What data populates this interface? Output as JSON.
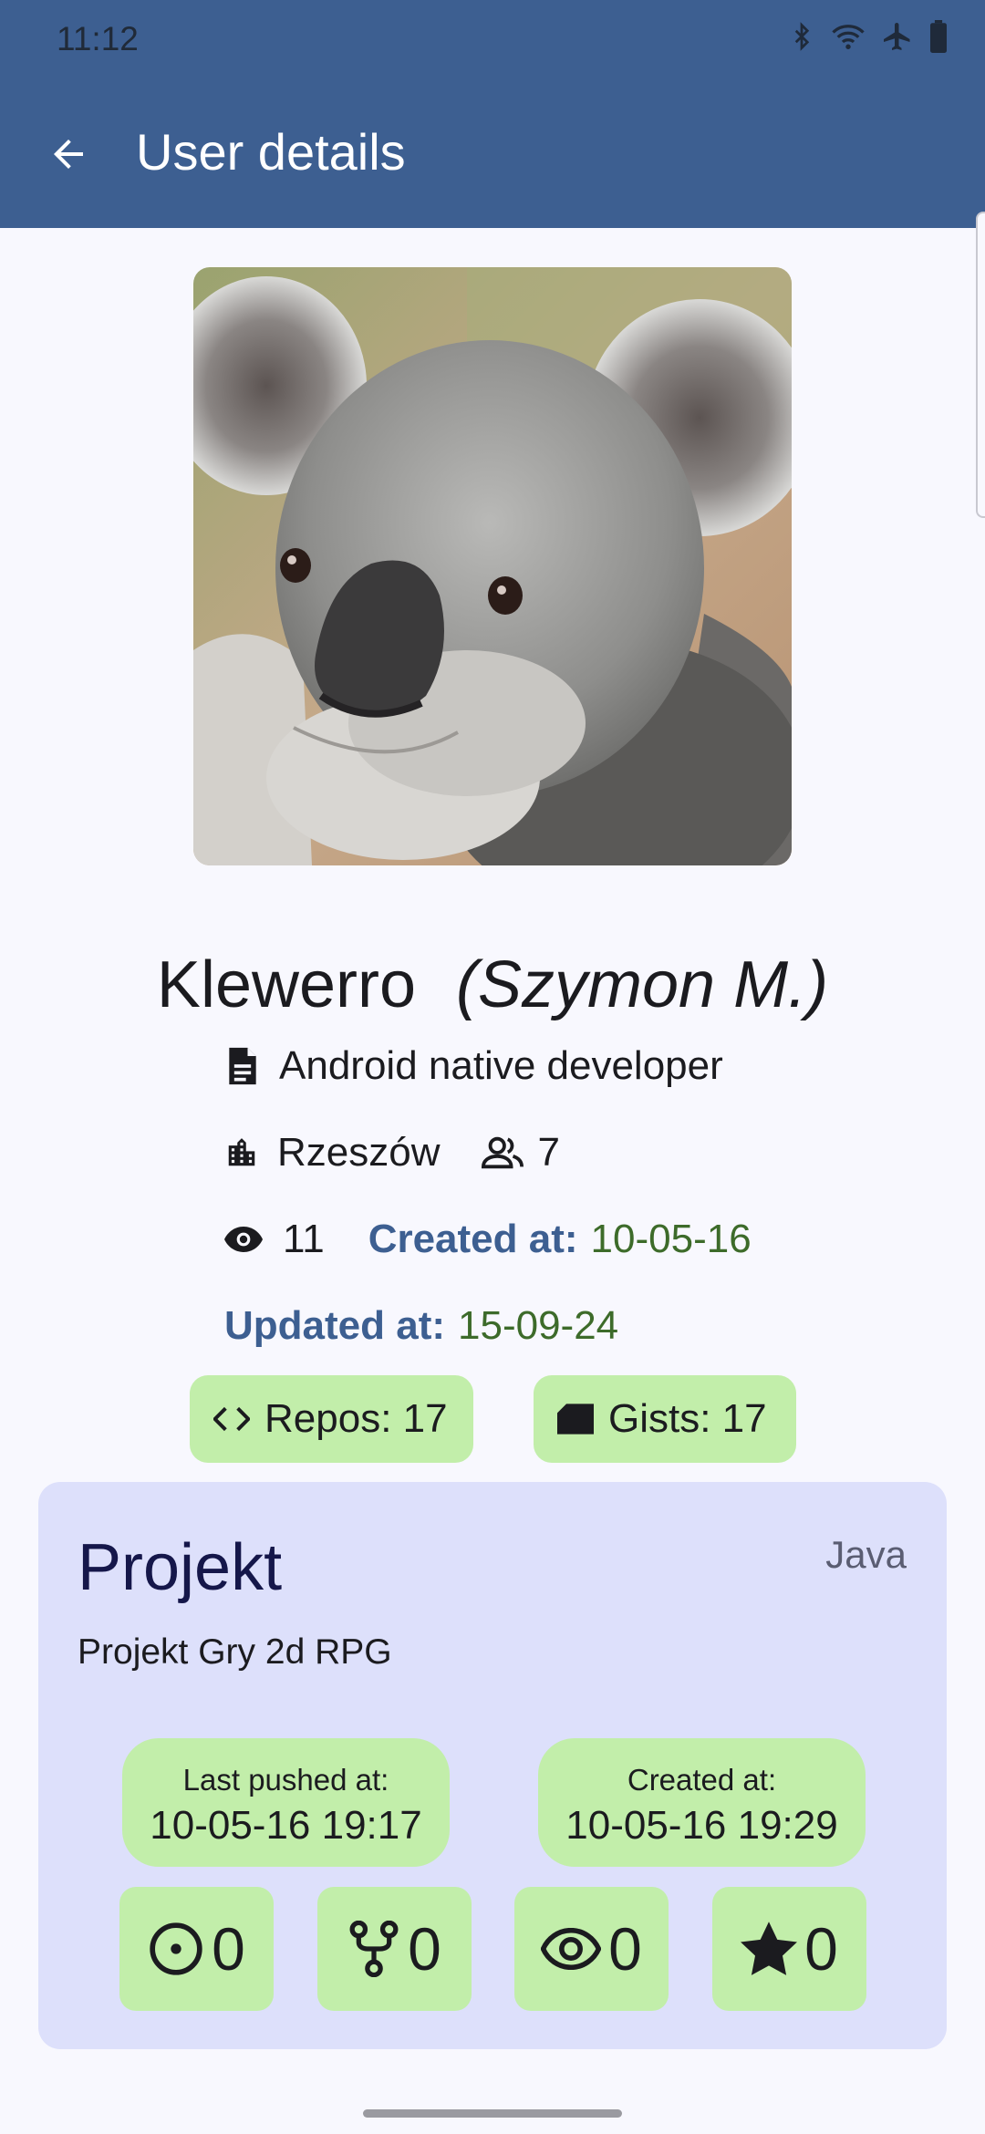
{
  "status_bar": {
    "time": "11:12",
    "icons": [
      "bluetooth-icon",
      "wifi-icon",
      "airplane-icon",
      "battery-icon"
    ]
  },
  "app_bar": {
    "title": "User details",
    "back_icon": "arrow-back-icon"
  },
  "profile": {
    "avatar_description_icon": "koala-photo",
    "login": "Klewerro",
    "full_name": "(Szymon M.)",
    "bio": "Android native developer",
    "location": "Rzeszów",
    "followers": "7",
    "watchers": "11",
    "created_label": "Created at:",
    "created_value": "10-05-16",
    "updated_label": "Updated at:",
    "updated_value": "15-09-24"
  },
  "chips": {
    "repos": "Repos: 17",
    "gists": "Gists: 17"
  },
  "repo_card": {
    "name": "Projekt",
    "language": "Java",
    "description": "Projekt Gry 2d RPG",
    "last_pushed_label": "Last pushed at:",
    "last_pushed_value": "10-05-16 19:17",
    "created_label": "Created at:",
    "created_value": "10-05-16 19:29",
    "stats": {
      "issues": "0",
      "forks": "0",
      "watchers": "0",
      "stars": "0"
    }
  },
  "colors": {
    "app_bar": "#3d5f91",
    "background": "#f8f8fe",
    "chip": "#c2eeaa",
    "card": "#dde0fb",
    "label_blue": "#3d5f91",
    "value_green": "#3d6b2a"
  }
}
